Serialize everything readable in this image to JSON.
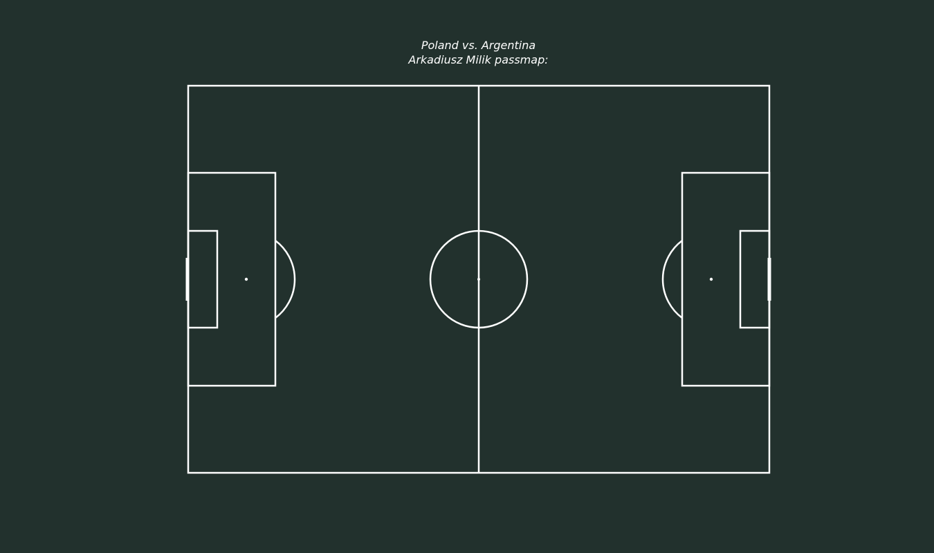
{
  "title": {
    "line1": "Poland vs. Argentina",
    "line2": "Arkadiusz Milik passmap:"
  },
  "colors": {
    "background": "#22312d",
    "lines": "#ffffff"
  }
}
